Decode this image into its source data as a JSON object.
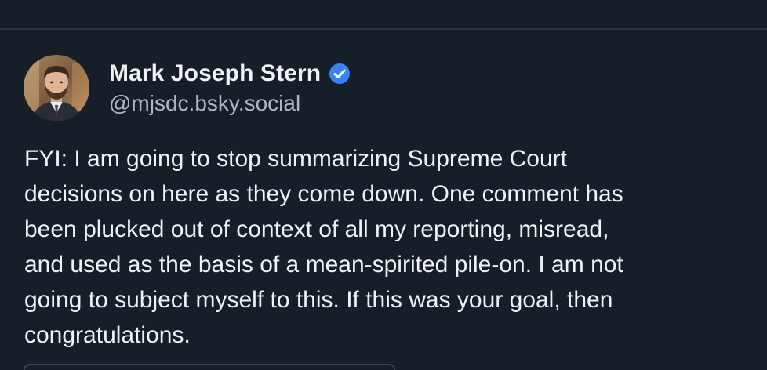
{
  "post": {
    "author": {
      "display_name": "Mark Joseph Stern",
      "handle": "@mjsdc.bsky.social",
      "verified": true,
      "avatar_icon": "profile-photo"
    },
    "text": "FYI: I am going to stop summarizing Supreme Court\ndecisions on here as they come down. One comment has\nbeen plucked out of context of all my reporting, misread,\nand used as the basis of a mean-spirited pile-on. I am not\ngoing to subject myself to this. If this was your goal, then\ncongratulations."
  },
  "colors": {
    "background": "#161e27",
    "divider": "#2e3845",
    "name": "#f1f3f5",
    "handle": "#aeb8c4",
    "verified_badge": "#3b82f6"
  }
}
